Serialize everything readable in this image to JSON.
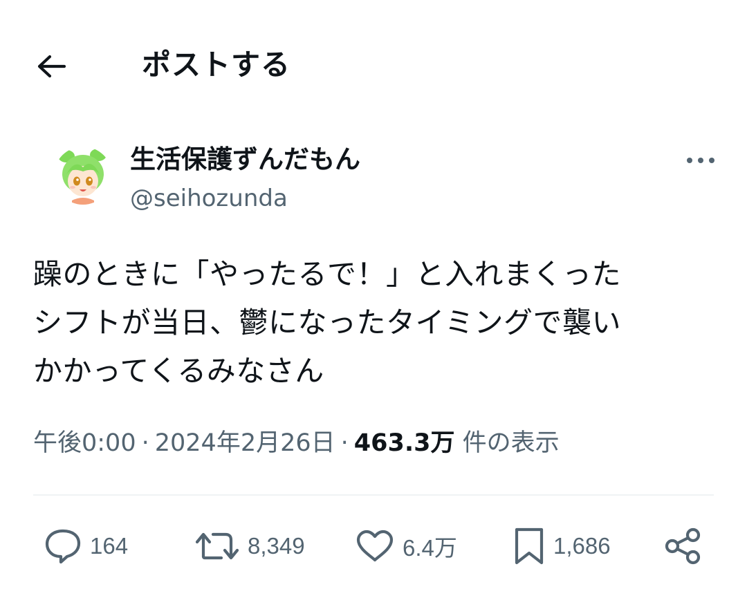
{
  "header": {
    "back_icon": "arrow-left-icon",
    "title": "ポストする"
  },
  "author": {
    "display_name": "生活保護ずんだもん",
    "handle": "@seihozunda",
    "more_icon": "more-horizontal-icon"
  },
  "tweet": {
    "lines": [
      "躁のときに「やったるで！」と入れまくった",
      "シフトが当日、鬱になったタイミングで襲い",
      "かかってくるみなさん"
    ]
  },
  "meta": {
    "time": "午後0:00",
    "date": "2024年2月26日",
    "views": "463.3万",
    "views_label": "件の表示"
  },
  "actions": {
    "reply": {
      "icon": "reply-icon",
      "count": "164"
    },
    "retweet": {
      "icon": "retweet-icon",
      "count": "8,349"
    },
    "like": {
      "icon": "heart-icon",
      "count": "6.4万"
    },
    "bookmark": {
      "icon": "bookmark-icon",
      "count": "1,686"
    },
    "share": {
      "icon": "share-icon"
    }
  },
  "colors": {
    "text_primary": "#0f1419",
    "text_secondary": "#536471",
    "divider": "#eff3f4",
    "avatar_hair": "#7ed957"
  }
}
